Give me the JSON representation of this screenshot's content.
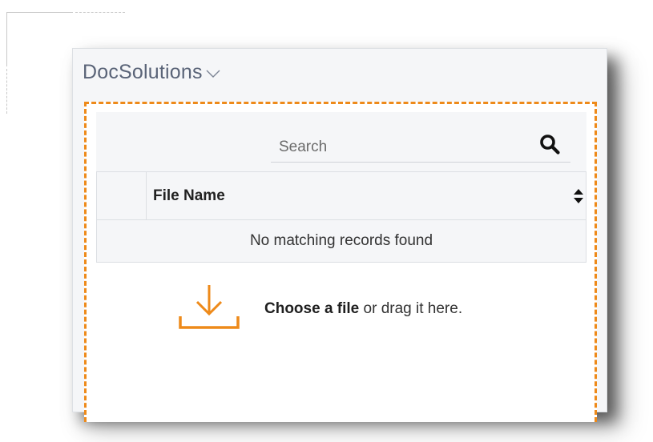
{
  "panel": {
    "title": "DocSolutions",
    "title_icon": "chevron-down-icon"
  },
  "search": {
    "placeholder": "Search",
    "value": "",
    "icon": "search-icon"
  },
  "table": {
    "columns": [
      "",
      "File Name"
    ],
    "sort_icon": "sort-both-icon",
    "empty_message": "No matching records found"
  },
  "upload": {
    "icon": "download-icon",
    "link_label": "Choose a file",
    "suffix": " or drag it here."
  },
  "colors": {
    "accent": "#ee8a1a",
    "title": "#5a6478",
    "panel_bg": "#f5f6f8"
  }
}
